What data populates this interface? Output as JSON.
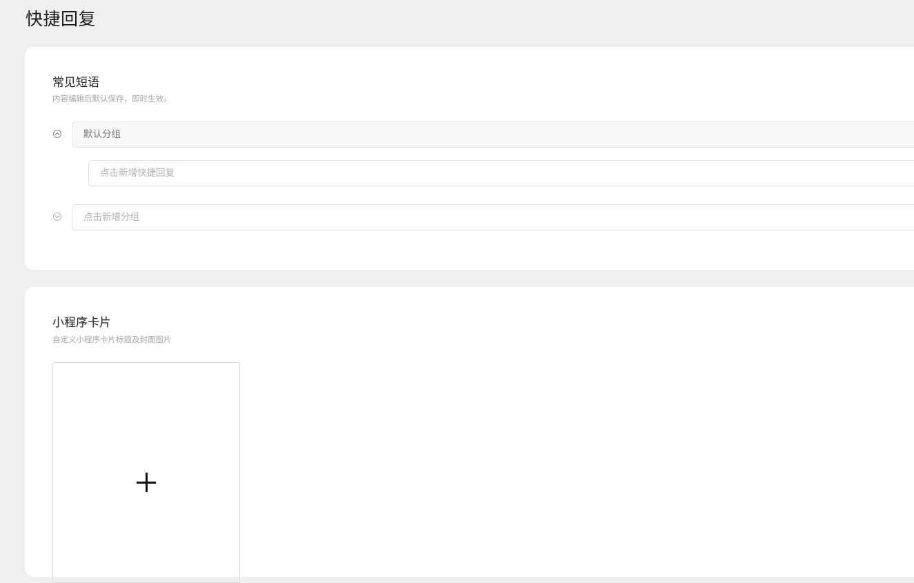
{
  "page": {
    "title": "快捷回复"
  },
  "phrases": {
    "title": "常见短语",
    "subtitle": "内容编辑后默认保存，即时生效。",
    "default_group": {
      "name": "默认分组",
      "toggle_icon": "chevron-up-circle-icon",
      "add_reply_placeholder": "点击新增快捷回复"
    },
    "new_group": {
      "toggle_icon": "chevron-down-circle-icon",
      "placeholder": "点击新增分组"
    }
  },
  "mini_program": {
    "title": "小程序卡片",
    "subtitle": "自定义小程序卡片标题及封面图片",
    "upload_icon": "plus-icon"
  }
}
